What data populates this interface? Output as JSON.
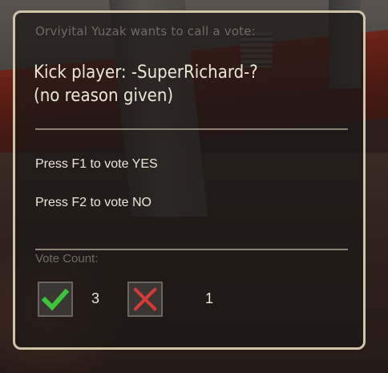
{
  "vote": {
    "caller_text": "Orviyital Yuzak wants to call a vote:",
    "issue_line1": "Kick player: -SuperRichard-?",
    "issue_line2": "(no reason given)",
    "yes_prompt": "Press F1 to vote YES",
    "no_prompt": "Press F2 to vote NO",
    "count_label": "Vote Count:",
    "yes_count": "3",
    "no_count": "1",
    "yes_icon": "check-icon",
    "no_icon": "cross-icon"
  },
  "colors": {
    "panel_border": "#cfc4a8",
    "check_green": "#3cc43c",
    "cross_red": "#d83a3a"
  }
}
